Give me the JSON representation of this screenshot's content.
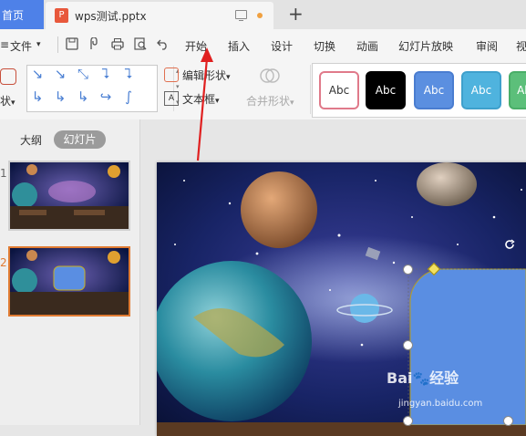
{
  "tabbar": {
    "home_label": "首页",
    "file_name": "wps测试.pptx",
    "new_tab": "+"
  },
  "menu": {
    "file_label": "文件",
    "items": [
      "开始",
      "插入",
      "设计",
      "切换",
      "动画",
      "幻灯片放映",
      "审阅",
      "视"
    ]
  },
  "tools": {
    "shape_label": "状",
    "edit_shape_label": "编辑形状",
    "textbox_label": "文本框",
    "merge_shape_label": "合并形状",
    "dropdown": "▾"
  },
  "style_gallery": [
    {
      "label": "Abc",
      "bg": "#ffffff",
      "border": "#e07a8a",
      "color": "#333333"
    },
    {
      "label": "Abc",
      "bg": "#000000",
      "border": "#000000",
      "color": "#ffffff"
    },
    {
      "label": "Abc",
      "bg": "#5b8fe0",
      "border": "#4a7dd0",
      "color": "#ffffff"
    },
    {
      "label": "Abc",
      "bg": "#4fb3de",
      "border": "#3ea0cc",
      "color": "#ffffff"
    },
    {
      "label": "Ab",
      "bg": "#5cbf7a",
      "border": "#4aae68",
      "color": "#ffffff"
    }
  ],
  "left_panel": {
    "outline_tab": "大纲",
    "slides_tab": "幻灯片",
    "slides": [
      {
        "number": "1",
        "active": false
      },
      {
        "number": "2",
        "active": true
      }
    ]
  },
  "colors": {
    "accent": "#4e81e8",
    "selected_shape": "#5a8ee2",
    "annotation_arrow": "#e02020",
    "active_thumb_border": "#e07b32"
  },
  "watermark": "jingyan.baidu.com"
}
